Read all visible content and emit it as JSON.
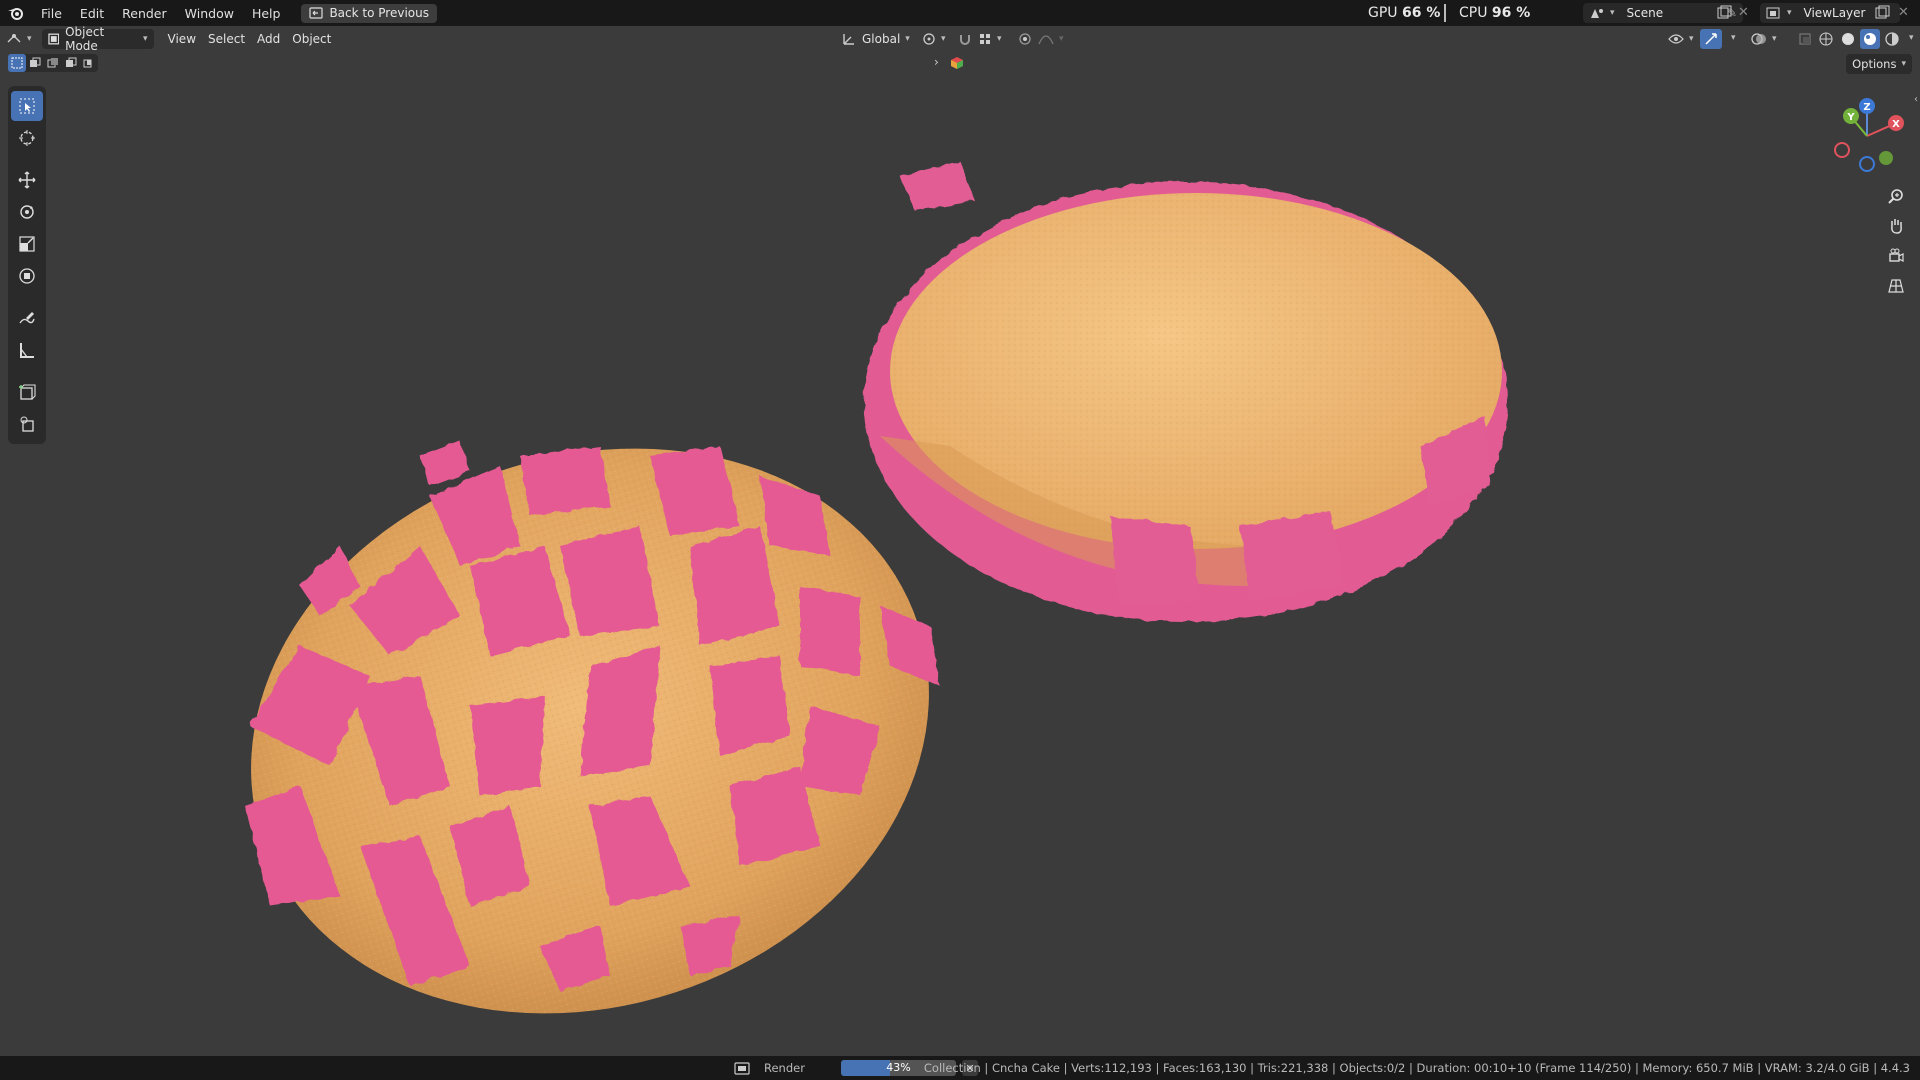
{
  "menu": {
    "items": [
      "File",
      "Edit",
      "Render",
      "Window",
      "Help"
    ],
    "back_label": "Back to Previous"
  },
  "perf": {
    "gpu_label": "GPU",
    "gpu_value": "66 %",
    "cpu_label": "CPU",
    "cpu_value": "96 %"
  },
  "scene": {
    "name": "Scene",
    "view_layer": "ViewLayer"
  },
  "viewport_header": {
    "mode": "Object Mode",
    "menus": [
      "View",
      "Select",
      "Add",
      "Object"
    ],
    "orientation": "Global",
    "options_label": "Options"
  },
  "gizmo": {
    "x": "X",
    "y": "Y",
    "z": "Z"
  },
  "status": {
    "render_label": "Render",
    "progress_percent": 43,
    "progress_text": "43%",
    "stats_text": "Collection | Cncha Cake | Verts:112,193 | Faces:163,130 | Tris:221,338 | Objects:0/2 | Duration: 00:10+10 (Frame 114/250) | Memory: 650.7 MiB | VRAM: 3.2/4.0 GiB | 4.4.3"
  },
  "colors": {
    "accent": "#4772b3",
    "viewport_bg": "#3b3b3b",
    "bread": "#e3a862",
    "topping": "#e55a93"
  }
}
